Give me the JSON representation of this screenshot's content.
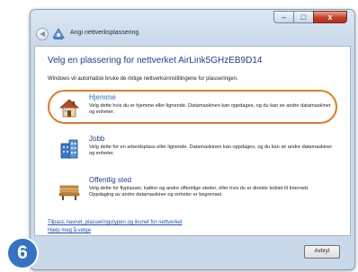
{
  "window": {
    "title": "Angi nettverksplassering",
    "buttons": {
      "minimize": "–",
      "maximize": "□",
      "close": "x"
    },
    "back_glyph": "◀"
  },
  "content": {
    "heading": "Velg en plassering for nettverket  AirLink5GHzEB9D14",
    "intro": "Windows vil automatisk bruke de riktige nettverksinnstillingene for plasseringen.",
    "options": [
      {
        "title": "Hjemme",
        "icon": "house-icon",
        "highlighted": true,
        "description": "Velg dette hvis du er hjemme eller lignende. Datamaskinen kan oppdages, og du kan se andre datamaskiner og enheter."
      },
      {
        "title": "Jobb",
        "icon": "office-building-icon",
        "highlighted": false,
        "description": "Velg dette for en arbeidsplass eller lignende. Datamaskinen kan oppdages, og du kan se andre datamaskiner og enheter."
      },
      {
        "title": "Offentlig sted",
        "icon": "park-bench-icon",
        "highlighted": false,
        "description": "Velg dette for flyplasser, kaféer og andre offentlige steder, eller hvis du er direkte koblet til Internett. Oppdaging av andre datamaskiner og enheter er begrenset."
      }
    ],
    "links": {
      "customize": "Tilpass navnet, plasseringstypen og ikonet for nettverket",
      "help": "Hjelp meg å velge"
    }
  },
  "footer": {
    "cancel_label": "Avbryt"
  },
  "step_badge": "6",
  "colors": {
    "highlight": "#e57a22",
    "heading": "#1f3d93",
    "badge": "#3572c4"
  }
}
